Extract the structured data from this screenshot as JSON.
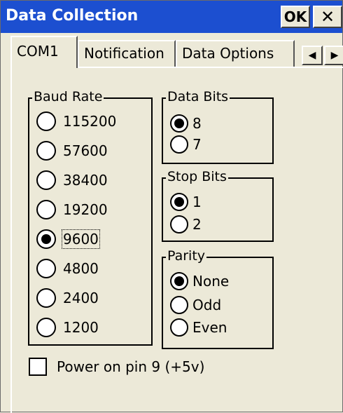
{
  "window": {
    "title": "Data Collection",
    "ok_label": "OK",
    "close_label": "✕"
  },
  "tabs": [
    {
      "label": "COM1",
      "active": true
    },
    {
      "label": "Notification",
      "active": false
    },
    {
      "label": "Data Options",
      "active": false
    }
  ],
  "tab_scroll": {
    "left": "◀",
    "right": "▶"
  },
  "baud_rate": {
    "label": "Baud Rate",
    "options": [
      "115200",
      "57600",
      "38400",
      "19200",
      "9600",
      "4800",
      "2400",
      "1200"
    ],
    "selected": "9600"
  },
  "data_bits": {
    "label": "Data Bits",
    "options": [
      "8",
      "7"
    ],
    "selected": "8"
  },
  "stop_bits": {
    "label": "Stop Bits",
    "options": [
      "1",
      "2"
    ],
    "selected": "1"
  },
  "parity": {
    "label": "Parity",
    "options": [
      "None",
      "Odd",
      "Even"
    ],
    "selected": "None"
  },
  "power_pin": {
    "label": "Power on pin 9 (+5v)",
    "checked": false
  },
  "colors": {
    "titlebar": "#1c4fd0",
    "face": "#ece9d8"
  }
}
